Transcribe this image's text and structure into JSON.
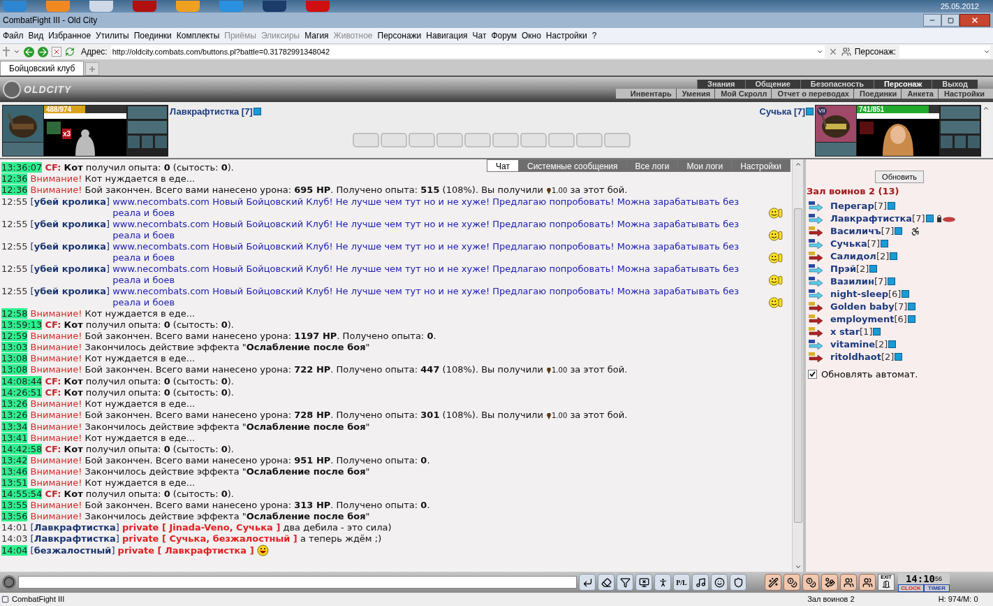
{
  "taskbar": {
    "date": "25.05.2012"
  },
  "window": {
    "title": "CombatFight III - Old City"
  },
  "menu": [
    {
      "label": "Файл",
      "disabled": false
    },
    {
      "label": "Вид",
      "disabled": false
    },
    {
      "label": "Избранное",
      "disabled": false
    },
    {
      "label": "Утилиты",
      "disabled": false
    },
    {
      "label": "Поединки",
      "disabled": false
    },
    {
      "label": "Комплекты",
      "disabled": false
    },
    {
      "label": "Приёмы",
      "disabled": true
    },
    {
      "label": "Эликсиры",
      "disabled": true
    },
    {
      "label": "Магия",
      "disabled": false
    },
    {
      "label": "Животное",
      "disabled": true
    },
    {
      "label": "Персонажи",
      "disabled": false
    },
    {
      "label": "Навигация",
      "disabled": false
    },
    {
      "label": "Чат",
      "disabled": false
    },
    {
      "label": "Форум",
      "disabled": false
    },
    {
      "label": "Окно",
      "disabled": false
    },
    {
      "label": "Настройки",
      "disabled": false
    },
    {
      "label": "?",
      "disabled": false
    }
  ],
  "address_bar": {
    "label": "Адрес:",
    "value": "http://oldcity.combats.com/buttons.pl?battle=0.31782991348042",
    "character_label": "Персонаж:"
  },
  "browser_tabs": [
    {
      "label": "Бойцовский клуб",
      "selected": true
    }
  ],
  "game_header": {
    "logo": "OLDCITY",
    "nav": [
      {
        "label": "Знания",
        "selected": false
      },
      {
        "label": "Общение",
        "selected": false
      },
      {
        "label": "Безопасность",
        "selected": false
      },
      {
        "label": "Персонаж",
        "selected": true
      },
      {
        "label": "Выход",
        "selected": false
      }
    ],
    "subnav": [
      "Инвентарь",
      "Умения",
      "Мой Скролл",
      "Отчет о переводах",
      "Поединки",
      "Анкета",
      "Настройки"
    ]
  },
  "fighters": [
    {
      "name": "Лавкрафтистка [7]",
      "hp": "488/974",
      "level": 0.5,
      "color": "#d9a21b",
      "badge": "x3"
    },
    {
      "name": "Сучька [7]",
      "hp": "741/851",
      "level": 0.87,
      "color": "#1fa82b",
      "badge": "VII"
    }
  ],
  "scrolls": [
    {
      "kind": "empty"
    },
    {
      "kind": "empty"
    },
    {
      "kind": "empty"
    },
    {
      "kind": "empty"
    },
    {
      "kind": "empty"
    },
    {
      "kind": "empty"
    },
    {
      "kind": "empty"
    },
    {
      "kind": "empty"
    },
    {
      "kind": "empty"
    },
    {
      "kind": "empty"
    }
  ],
  "chat_tabs": [
    {
      "label": "Чат",
      "selected": true
    },
    {
      "label": "Системные сообщения",
      "selected": false
    },
    {
      "label": "Все логи",
      "selected": false
    },
    {
      "label": "Мои логи",
      "selected": false
    },
    {
      "label": "Настройки",
      "selected": false
    }
  ],
  "chat": [
    {
      "time": "13:36:07",
      "highlight": true,
      "kind": "cf",
      "label": "CF:",
      "text": "**Кот** получил опыта: **0** (сытость: **0**)."
    },
    {
      "time": "12:36",
      "highlight": true,
      "kind": "alert",
      "label": "Внимание!",
      "text": "Кот нуждается в еде..."
    },
    {
      "time": "12:36",
      "highlight": true,
      "kind": "alert",
      "label": "Внимание!",
      "text": "Бой закончен. Всего вами нанесено урона: **695 HP**. Получено опыта: **515** (108%). Вы получили",
      "reward": {
        "amount": "1.00",
        "tail": "за этот бой."
      }
    },
    {
      "time": "12:55",
      "highlight": false,
      "kind": "user",
      "sender": "[**убей кролика**]",
      "text": "www.necombats.com Новый Бойцовский Клуб! Не лучше чем тут но и не хуже! Предлагаю попробовать! Можна зарабатывать без реала и боев",
      "smiley": {
        "kind": "thumbs"
      }
    },
    {
      "time": "12:55",
      "highlight": false,
      "kind": "user",
      "sender": "[**убей кролика**]",
      "text": "www.necombats.com Новый Бойцовский Клуб! Не лучше чем тут но и не хуже! Предлагаю попробовать! Можна зарабатывать без реала и боев",
      "smiley": {
        "kind": "thumbs"
      }
    },
    {
      "time": "12:55",
      "highlight": false,
      "kind": "user",
      "sender": "[**убей кролика**]",
      "text": "www.necombats.com Новый Бойцовский Клуб! Не лучше чем тут но и не хуже! Предлагаю попробовать! Можна зарабатывать без реала и боев",
      "smiley": {
        "kind": "thumbs"
      }
    },
    {
      "time": "12:55",
      "highlight": false,
      "kind": "user",
      "sender": "[**убей кролика**]",
      "text": "www.necombats.com Новый Бойцовский Клуб! Не лучше чем тут но и не хуже! Предлагаю попробовать! Можна зарабатывать без реала и боев",
      "smiley": {
        "kind": "thumbs"
      }
    },
    {
      "time": "12:55",
      "highlight": false,
      "kind": "user",
      "sender": "[**убей кролика**]",
      "text": "www.necombats.com Новый Бойцовский Клуб! Не лучше чем тут но и не хуже! Предлагаю попробовать! Можна зарабатывать без реала и боев",
      "smiley": {
        "kind": "thumbs"
      }
    },
    {
      "time": "12:58",
      "highlight": true,
      "kind": "alert",
      "label": "Внимание!",
      "text": "Кот нуждается в еде..."
    },
    {
      "time": "13:59:13",
      "highlight": true,
      "kind": "cf",
      "label": "CF:",
      "text": "**Кот** получил опыта: **0** (сытость: **0**)."
    },
    {
      "time": "12:59",
      "highlight": true,
      "kind": "alert",
      "label": "Внимание!",
      "text": "Бой закончен. Всего вами нанесено урона: **1197 HP**. Получено опыта: **0**."
    },
    {
      "time": "13:03",
      "highlight": true,
      "kind": "alert",
      "label": "Внимание!",
      "text": "Закончилось действие эффекта \"**Ослабление после боя**\""
    },
    {
      "time": "13:08",
      "highlight": true,
      "kind": "alert",
      "label": "Внимание!",
      "text": "Кот нуждается в еде..."
    },
    {
      "time": "13:08",
      "highlight": true,
      "kind": "alert",
      "label": "Внимание!",
      "text": "Бой закончен. Всего вами нанесено урона: **722 HP**. Получено опыта: **447** (108%). Вы получили",
      "reward": {
        "amount": "1.00",
        "tail": "за этот бой."
      }
    },
    {
      "time": "14:08:44",
      "highlight": true,
      "kind": "cf",
      "label": "CF:",
      "text": "**Кот** получил опыта: **0** (сытость: **0**)."
    },
    {
      "time": "14:26:51",
      "highlight": true,
      "kind": "cf",
      "label": "CF:",
      "text": "**Кот** получил опыта: **0** (сытость: **0**)."
    },
    {
      "time": "13:26",
      "highlight": true,
      "kind": "alert",
      "label": "Внимание!",
      "text": "Кот нуждается в еде..."
    },
    {
      "time": "13:26",
      "highlight": true,
      "kind": "alert",
      "label": "Внимание!",
      "text": "Бой закончен. Всего вами нанесено урона: **728 HP**. Получено опыта: **301** (108%). Вы получили",
      "reward": {
        "amount": "1.00",
        "tail": "за этот бой."
      }
    },
    {
      "time": "13:34",
      "highlight": true,
      "kind": "alert",
      "label": "Внимание!",
      "text": "Закончилось действие эффекта \"**Ослабление после боя**\""
    },
    {
      "time": "13:41",
      "highlight": true,
      "kind": "alert",
      "label": "Внимание!",
      "text": "Кот нуждается в еде..."
    },
    {
      "time": "14:42:58",
      "highlight": true,
      "kind": "cf",
      "label": "CF:",
      "text": "**Кот** получил опыта: **0** (сытость: **0**)."
    },
    {
      "time": "13:42",
      "highlight": true,
      "kind": "alert",
      "label": "Внимание!",
      "text": "Бой закончен. Всего вами нанесено урона: **951 HP**. Получено опыта: **0**."
    },
    {
      "time": "13:46",
      "highlight": true,
      "kind": "alert",
      "label": "Внимание!",
      "text": "Закончилось действие эффекта \"**Ослабление после боя**\""
    },
    {
      "time": "13:51",
      "highlight": true,
      "kind": "alert",
      "label": "Внимание!",
      "text": "Кот нуждается в еде..."
    },
    {
      "time": "14:55:54",
      "highlight": true,
      "kind": "cf",
      "label": "CF:",
      "text": "**Кот** получил опыта: **0** (сытость: **0**)."
    },
    {
      "time": "13:55",
      "highlight": true,
      "kind": "alert",
      "label": "Внимание!",
      "text": "Бой закончен. Всего вами нанесено урона: **313 HP**. Получено опыта: **0**."
    },
    {
      "time": "13:56",
      "highlight": true,
      "kind": "alert",
      "label": "Внимание!",
      "text": "Закончилось действие эффекта \"**Ослабление после боя**\""
    },
    {
      "time": "14:01",
      "highlight": false,
      "kind": "private",
      "sender": "[**Лавкрафтистка**]",
      "to": "private [ Jinada-Veno, Сучька ]",
      "text": "два дебила - это сила)"
    },
    {
      "time": "14:03",
      "highlight": false,
      "kind": "private",
      "sender": "[**Лавкрафтистка**]",
      "to": "private [ Сучька, безжалостный ]",
      "text": "а теперь ждём ;)"
    },
    {
      "time": "14:04",
      "highlight": true,
      "kind": "private",
      "sender": "[**безжалостный**]",
      "to": "private [ Лавкрафтистка ]",
      "smiley": {
        "kind": "laugh"
      }
    }
  ],
  "room": {
    "refresh_button": "Обновить",
    "title": "Зал воинов 2 (13)",
    "players": [
      {
        "name": "Перегар",
        "rank": "[7]",
        "kind": "blue"
      },
      {
        "name": "Лавкрафтистка",
        "rank": "[7]",
        "kind": "blue",
        "status": {
          "kind": "lock"
        }
      },
      {
        "name": "Василичъ",
        "rank": "[7]",
        "kind": "red",
        "status": {
          "kind": "injury"
        }
      },
      {
        "name": "Сучька",
        "rank": "[7]",
        "kind": "blue"
      },
      {
        "name": "Салидол",
        "rank": "[2]",
        "kind": "red"
      },
      {
        "name": "Прэй",
        "rank": "[2]",
        "kind": "blue"
      },
      {
        "name": "Вазилин",
        "rank": "[7]",
        "kind": "blue"
      },
      {
        "name": "night-sleep",
        "rank": "[6]",
        "kind": "blue"
      },
      {
        "name": "Golden baby",
        "rank": "[7]",
        "kind": "red"
      },
      {
        "name": "employment",
        "rank": "[6]",
        "kind": "red"
      },
      {
        "name": "x star",
        "rank": "[1]",
        "kind": "red"
      },
      {
        "name": "vitamine",
        "rank": "[2]",
        "kind": "blue"
      },
      {
        "name": "ritoldhaot",
        "rank": "[2]",
        "kind": "red"
      }
    ],
    "auto_refresh": {
      "label": "Обновлять автомат.",
      "checked": true
    }
  },
  "bottom_bar": {
    "pl_button": "P/L",
    "exit_label": "EXIT",
    "clock": {
      "time": "14:10",
      "seconds": "56",
      "clock_label": "CLOCK",
      "timer_label": "TIMER"
    }
  },
  "status_bar": {
    "app": "CombatFight III",
    "room": "Зал воинов 2",
    "stats": "H: 974/M: 0"
  }
}
